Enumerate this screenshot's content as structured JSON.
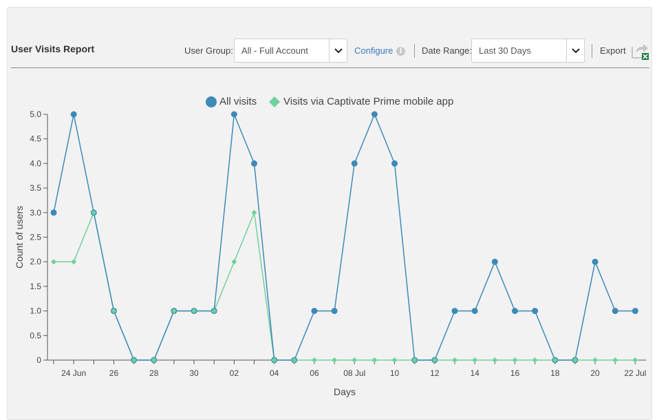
{
  "header": {
    "title": "User Visits Report",
    "user_group_label": "User Group:",
    "user_group_value": "All - Full Account",
    "configure_label": "Configure",
    "date_range_label": "Date Range:",
    "date_range_value": "Last 30 Days",
    "export_label": "Export"
  },
  "icons": {
    "info": "info-icon",
    "dropdown": "chevron-down-icon",
    "export": "export-excel-icon"
  },
  "colors": {
    "all_visits": "#3d8ab8",
    "mobile_visits": "#72d19a",
    "excel_badge": "#1d7a3e"
  },
  "chart_data": {
    "type": "line",
    "xlabel": "Days",
    "ylabel": "Count of users",
    "ylim": [
      0,
      5
    ],
    "yticks": [
      "0",
      "0.5",
      "1.0",
      "1.5",
      "2.0",
      "2.5",
      "3.0",
      "3.5",
      "4.0",
      "4.5",
      "5.0"
    ],
    "x": [
      "23 Jun",
      "24 Jun",
      "25 Jun",
      "26 Jun",
      "27 Jun",
      "28 Jun",
      "29 Jun",
      "30 Jun",
      "01 Jul",
      "02 Jul",
      "03 Jul",
      "04 Jul",
      "05 Jul",
      "06 Jul",
      "07 Jul",
      "08 Jul",
      "09 Jul",
      "10 Jul",
      "11 Jul",
      "12 Jul",
      "13 Jul",
      "14 Jul",
      "15 Jul",
      "16 Jul",
      "17 Jul",
      "18 Jul",
      "19 Jul",
      "20 Jul",
      "21 Jul",
      "22 Jul"
    ],
    "xtick_labels": [
      {
        "index": 1,
        "label": "24 Jun"
      },
      {
        "index": 3,
        "label": "26"
      },
      {
        "index": 5,
        "label": "28"
      },
      {
        "index": 7,
        "label": "30"
      },
      {
        "index": 9,
        "label": "02"
      },
      {
        "index": 11,
        "label": "04"
      },
      {
        "index": 13,
        "label": "06"
      },
      {
        "index": 15,
        "label": "08 Jul"
      },
      {
        "index": 17,
        "label": "10"
      },
      {
        "index": 19,
        "label": "12"
      },
      {
        "index": 21,
        "label": "14"
      },
      {
        "index": 23,
        "label": "16"
      },
      {
        "index": 25,
        "label": "18"
      },
      {
        "index": 27,
        "label": "20"
      },
      {
        "index": 29,
        "label": "22 Jul"
      }
    ],
    "legend_position": "top-center",
    "series": [
      {
        "name": "All visits",
        "marker": "circle",
        "values": [
          3,
          5,
          3,
          1,
          0,
          0,
          1,
          1,
          1,
          5,
          4,
          0,
          0,
          1,
          1,
          4,
          5,
          4,
          0,
          0,
          1,
          1,
          2,
          1,
          1,
          0,
          0,
          2,
          1,
          1
        ]
      },
      {
        "name": "Visits via Captivate Prime mobile app",
        "marker": "diamond",
        "values": [
          2,
          2,
          3,
          1,
          0,
          0,
          1,
          1,
          1,
          2,
          3,
          0,
          0,
          0,
          0,
          0,
          0,
          0,
          0,
          0,
          0,
          0,
          0,
          0,
          0,
          0,
          0,
          0,
          0,
          0
        ]
      }
    ]
  }
}
